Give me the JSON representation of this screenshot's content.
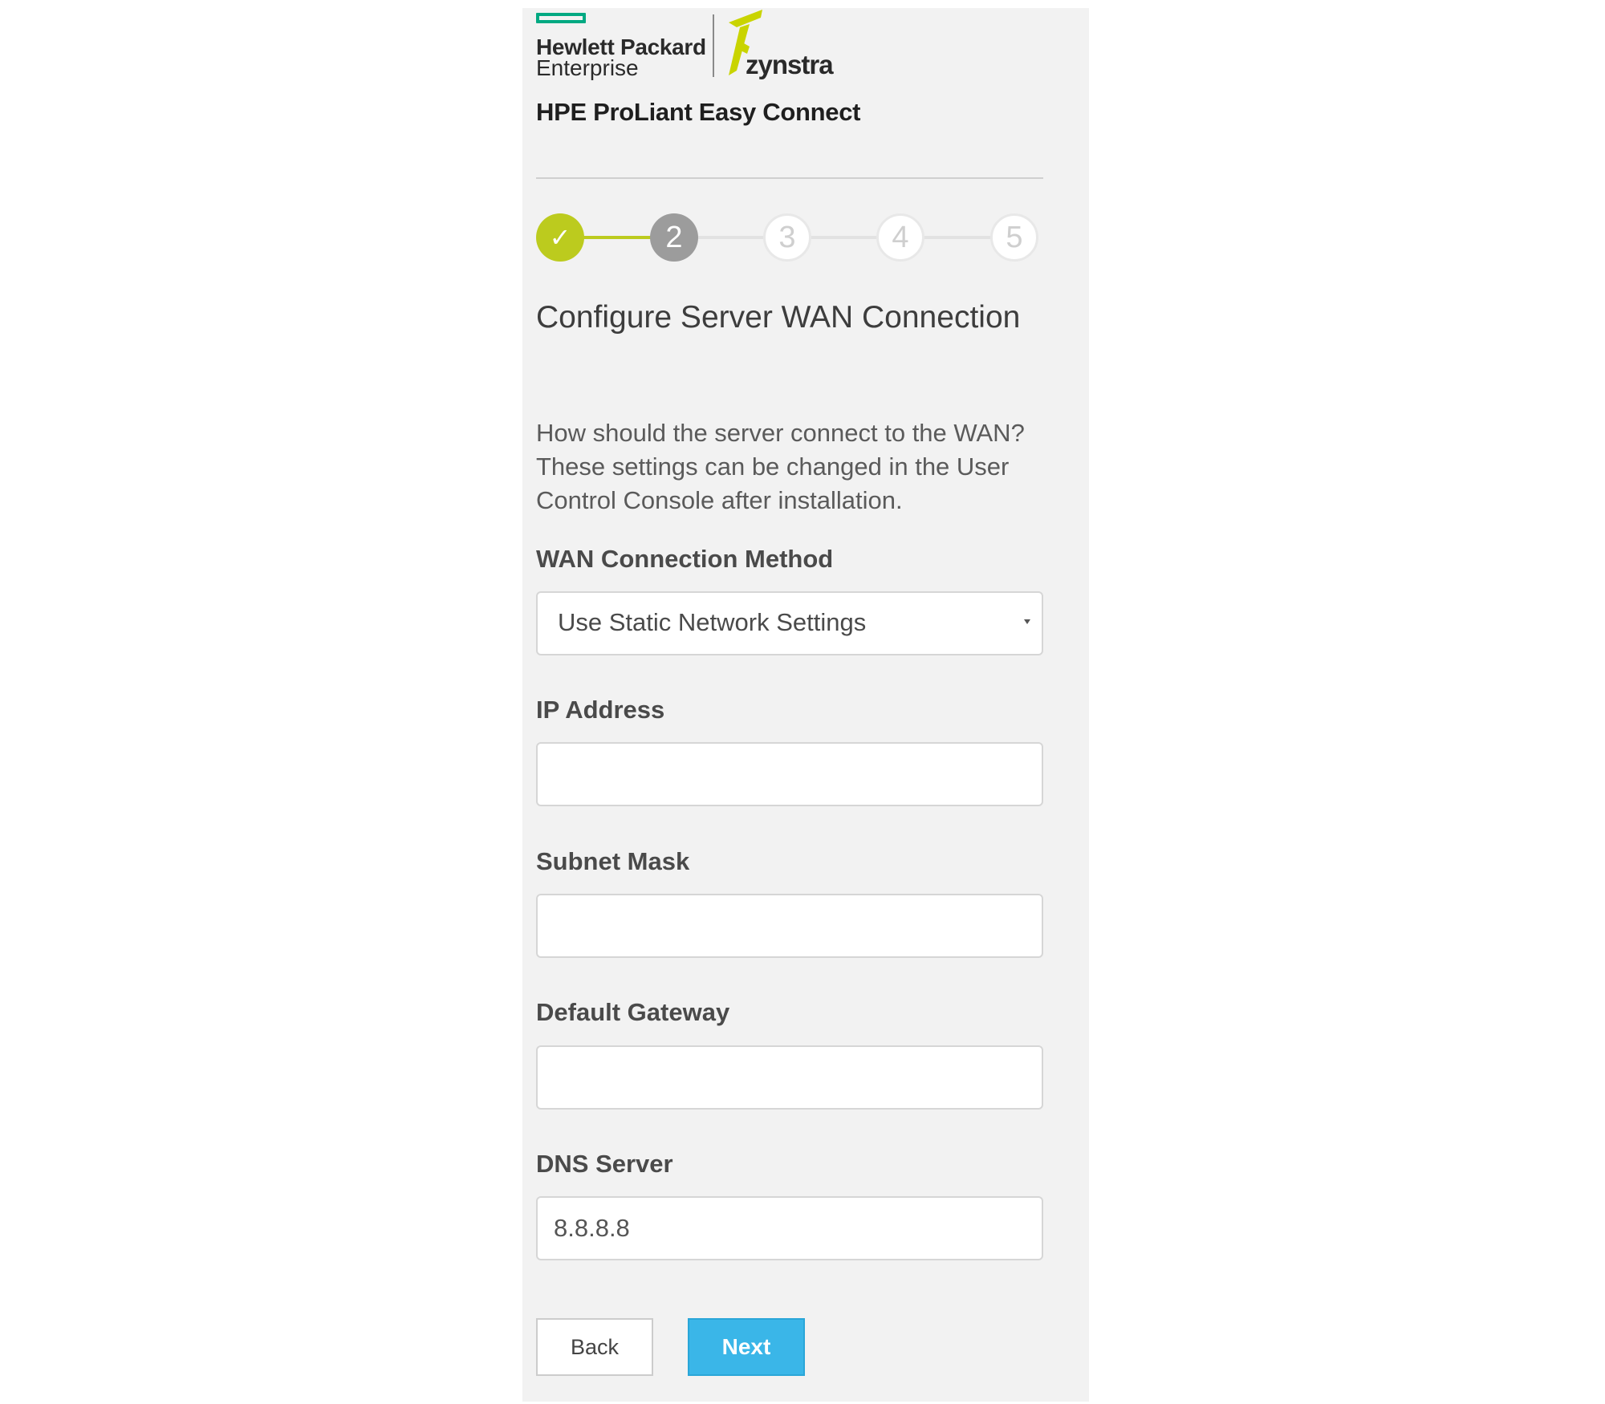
{
  "header": {
    "brand_line1": "Hewlett Packard",
    "brand_line2": "Enterprise",
    "partner_logo": "zynstra",
    "product_title": "HPE ProLiant Easy Connect"
  },
  "stepper": {
    "current_step": 2,
    "total_steps": 5,
    "steps": [
      {
        "label": "✓",
        "state": "done"
      },
      {
        "label": "2",
        "state": "current"
      },
      {
        "label": "3",
        "state": "pending"
      },
      {
        "label": "4",
        "state": "pending"
      },
      {
        "label": "5",
        "state": "pending"
      }
    ]
  },
  "page": {
    "heading": "Configure Server WAN Connection",
    "description": "How should the server connect to the WAN? These settings can be changed in the User Control Console after installation."
  },
  "form": {
    "wan_method": {
      "label": "WAN Connection Method",
      "selected": "Use Static Network Settings"
    },
    "ip_address": {
      "label": "IP Address",
      "value": ""
    },
    "subnet_mask": {
      "label": "Subnet Mask",
      "value": ""
    },
    "default_gateway": {
      "label": "Default Gateway",
      "value": ""
    },
    "dns_server": {
      "label": "DNS Server",
      "value": "8.8.8.8"
    }
  },
  "buttons": {
    "back": "Back",
    "next": "Next"
  },
  "colors": {
    "hpe_green": "#01a982",
    "step_done": "#bccb1e",
    "step_current": "#9c9c9c",
    "next_button": "#3ab6e8",
    "panel_background": "#f2f2f2"
  }
}
